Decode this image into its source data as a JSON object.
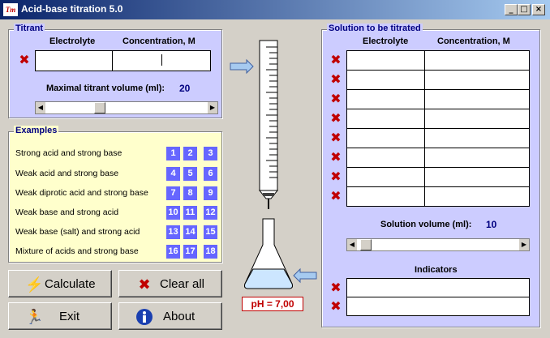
{
  "window": {
    "title": "Acid-base titration 5.0",
    "icon_text": "Tm",
    "controls": [
      "_",
      "□",
      "×"
    ]
  },
  "titrant": {
    "legend": "Titrant",
    "col_electrolyte": "Electrolyte",
    "col_concentration": "Concentration, M",
    "electrolyte_value": "",
    "concentration_value": "",
    "max_volume_label": "Maximal titrant volume (ml):",
    "max_volume_value": "20"
  },
  "examples": {
    "legend": "Examples",
    "rows": [
      {
        "label": "Strong acid and strong base",
        "nums": [
          "1",
          "2",
          "3"
        ]
      },
      {
        "label": "Weak acid and strong base",
        "nums": [
          "4",
          "5",
          "6"
        ]
      },
      {
        "label": "Weak diprotic acid and strong base",
        "nums": [
          "7",
          "8",
          "9"
        ]
      },
      {
        "label": "Weak base and strong acid",
        "nums": [
          "10",
          "11",
          "12"
        ]
      },
      {
        "label": "Weak base (salt) and strong acid",
        "nums": [
          "13",
          "14",
          "15"
        ]
      },
      {
        "label": "Mixture of acids and strong base",
        "nums": [
          "16",
          "17",
          "18"
        ]
      }
    ]
  },
  "buttons": {
    "calculate": "Calculate",
    "clear_all": "Clear all",
    "exit": "Exit",
    "about": "About"
  },
  "ph_display": "pH = 7,00",
  "solution": {
    "legend": "Solution to be titrated",
    "col_electrolyte": "Electrolyte",
    "col_concentration": "Concentration, M",
    "volume_label": "Solution volume (ml):",
    "volume_value": "10",
    "indicators_label": "Indicators"
  },
  "colors": {
    "panel_blue": "#ccccff",
    "panel_yellow": "#ffffcc",
    "num_button": "#6666ff",
    "delete_red": "#c00000",
    "title_text": "#000080"
  },
  "icons": {
    "delete": "red-x-icon",
    "calculate": "lightning-icon",
    "clear": "red-x-icon",
    "exit": "running-man-icon",
    "about": "info-icon"
  }
}
